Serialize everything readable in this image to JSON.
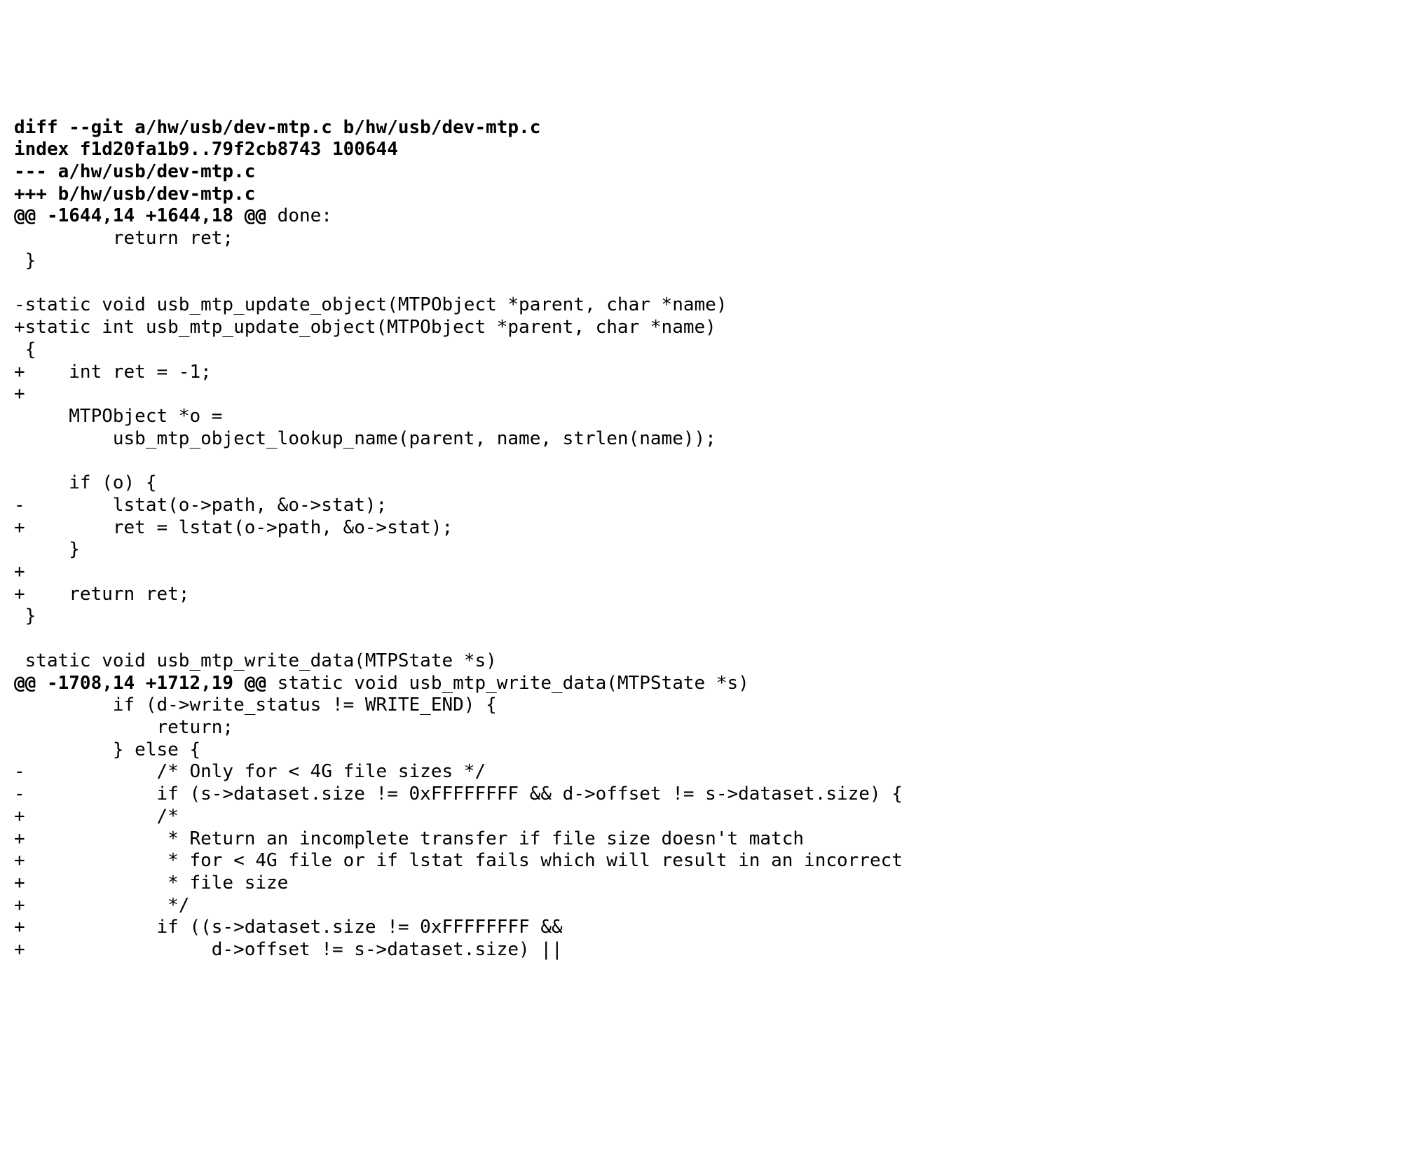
{
  "diff": {
    "lines": [
      {
        "text": "diff --git a/hw/usb/dev-mtp.c b/hw/usb/dev-mtp.c",
        "bold": true
      },
      {
        "text": "index f1d20fa1b9..79f2cb8743 100644",
        "bold": true
      },
      {
        "text": "--- a/hw/usb/dev-mtp.c",
        "bold": true
      },
      {
        "text": "+++ b/hw/usb/dev-mtp.c",
        "bold": true
      },
      {
        "text": "@@ -1644,14 +1644,18 @@",
        "bold": true,
        "tail": " done:"
      },
      {
        "text": "         return ret;"
      },
      {
        "text": " }"
      },
      {
        "text": " "
      },
      {
        "text": "-static void usb_mtp_update_object(MTPObject *parent, char *name)"
      },
      {
        "text": "+static int usb_mtp_update_object(MTPObject *parent, char *name)"
      },
      {
        "text": " {"
      },
      {
        "text": "+    int ret = -1;"
      },
      {
        "text": "+"
      },
      {
        "text": "     MTPObject *o ="
      },
      {
        "text": "         usb_mtp_object_lookup_name(parent, name, strlen(name));"
      },
      {
        "text": " "
      },
      {
        "text": "     if (o) {"
      },
      {
        "text": "-        lstat(o->path, &o->stat);"
      },
      {
        "text": "+        ret = lstat(o->path, &o->stat);"
      },
      {
        "text": "     }"
      },
      {
        "text": "+"
      },
      {
        "text": "+    return ret;"
      },
      {
        "text": " }"
      },
      {
        "text": " "
      },
      {
        "text": " static void usb_mtp_write_data(MTPState *s)"
      },
      {
        "text": "@@ -1708,14 +1712,19 @@",
        "bold": true,
        "tail": " static void usb_mtp_write_data(MTPState *s)"
      },
      {
        "text": "         if (d->write_status != WRITE_END) {"
      },
      {
        "text": "             return;"
      },
      {
        "text": "         } else {"
      },
      {
        "text": "-            /* Only for < 4G file sizes */"
      },
      {
        "text": "-            if (s->dataset.size != 0xFFFFFFFF && d->offset != s->dataset.size) {"
      },
      {
        "text": "+            /*"
      },
      {
        "text": "+             * Return an incomplete transfer if file size doesn't match"
      },
      {
        "text": "+             * for < 4G file or if lstat fails which will result in an incorrect"
      },
      {
        "text": "+             * file size"
      },
      {
        "text": "+             */"
      },
      {
        "text": "+            if ((s->dataset.size != 0xFFFFFFFF &&"
      },
      {
        "text": "+                 d->offset != s->dataset.size) ||"
      }
    ]
  }
}
